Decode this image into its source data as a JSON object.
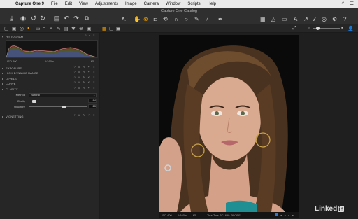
{
  "menubar": {
    "app_name": "Capture One 9",
    "items": [
      "File",
      "Edit",
      "View",
      "Adjustments",
      "Image",
      "Camera",
      "Window",
      "Scripts",
      "Help"
    ]
  },
  "window": {
    "title": "Capture One Catalog"
  },
  "panel": {
    "sections": {
      "histogram": "HISTOGRAM",
      "exposure": "EXPOSURE",
      "hdr": "HIGH DYNAMIC RANGE",
      "levels": "LEVELS",
      "curve": "CURVE",
      "clarity": "CLARITY",
      "vignetting": "VIGNETTING"
    },
    "histogram_info": {
      "iso": "ISO 400",
      "shutter": "1/160 s",
      "aperture": "f/5"
    },
    "clarity": {
      "method_label": "Method",
      "method_value": "Natural",
      "clarity_label": "Clarity",
      "clarity_value": "-84",
      "clarity_level": -84,
      "structure_label": "Structure",
      "structure_value": "20",
      "structure_level": 20
    }
  },
  "viewer": {
    "status": {
      "iso": "ISO 400",
      "shutter": "1/160 s",
      "aperture": "f/5",
      "filename": "Tina-Tina-PC1690-76.ORF"
    }
  },
  "watermark": {
    "text": "Linked",
    "suffix": "in"
  },
  "colors": {
    "accent": "#f0a000",
    "rating_blue": "#2c78d4"
  }
}
